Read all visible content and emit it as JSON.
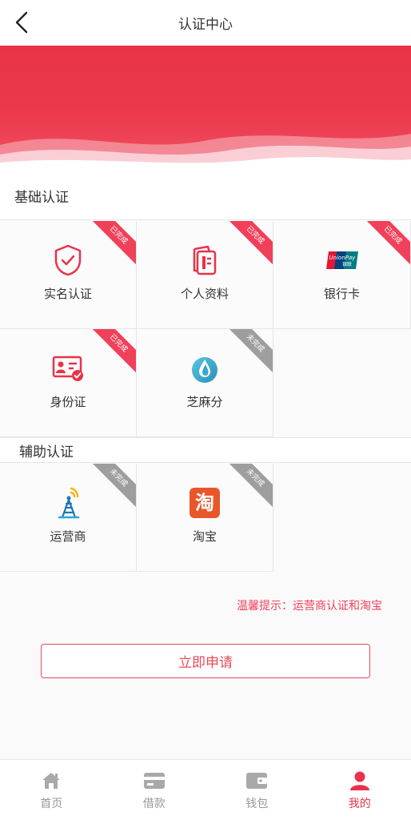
{
  "header": {
    "title": "认证中心"
  },
  "basic": {
    "title": "基础认证",
    "items": [
      {
        "label": "实名认证",
        "status": "已完成"
      },
      {
        "label": "个人资料",
        "status": "已完成"
      },
      {
        "label": "银行卡",
        "status": "已完成",
        "icon_text": "UnionPay 银联"
      },
      {
        "label": "身份证",
        "status": "已完成"
      },
      {
        "label": "芝麻分",
        "status": "未完成"
      }
    ]
  },
  "aux": {
    "title": "辅助认证",
    "items": [
      {
        "label": "运营商",
        "status": "未完成"
      },
      {
        "label": "淘宝",
        "status": "未完成",
        "icon_text": "淘"
      }
    ]
  },
  "tip": "温馨提示：运营商认证和淘宝",
  "apply_button": "立即申请",
  "tabs": [
    {
      "label": "首页"
    },
    {
      "label": "借款"
    },
    {
      "label": "钱包"
    },
    {
      "label": "我的"
    }
  ],
  "colors": {
    "accent": "#e8334a",
    "done": "#f0405a",
    "todo": "#9e9e9e"
  }
}
